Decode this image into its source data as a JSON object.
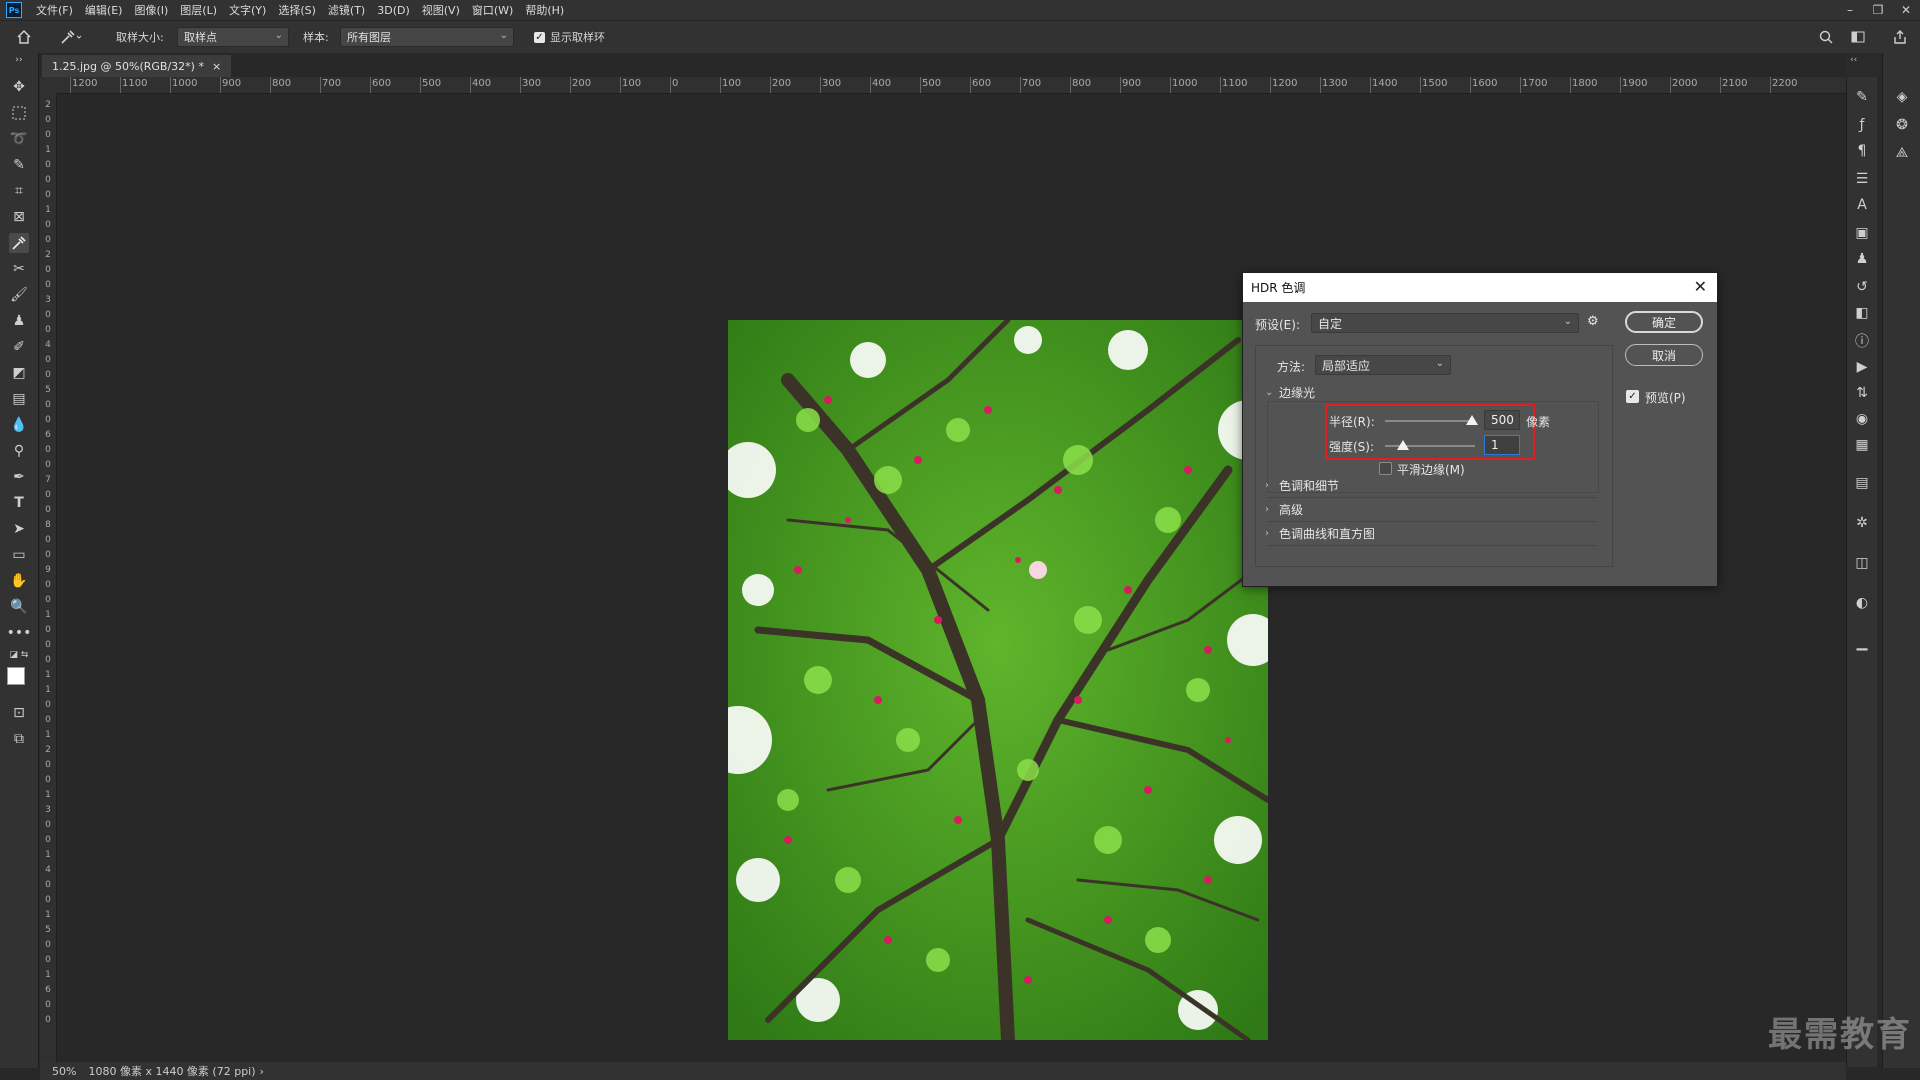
{
  "menubar": {
    "logo": "Ps",
    "items": [
      "文件(F)",
      "编辑(E)",
      "图像(I)",
      "图层(L)",
      "文字(Y)",
      "选择(S)",
      "滤镜(T)",
      "3D(D)",
      "视图(V)",
      "窗口(W)",
      "帮助(H)"
    ],
    "window_controls": [
      "–",
      "❐",
      "✕"
    ]
  },
  "options": {
    "sample_size_label": "取样大小:",
    "sample_size_value": "取样点",
    "sample_label": "样本:",
    "sample_value": "所有图层",
    "show_ring_label": "显示取样环",
    "show_ring_checked": true
  },
  "document": {
    "tab_title": "1.25.jpg @ 50%(RGB/32*) *",
    "tab_close": "×"
  },
  "ruler": {
    "h_labels": [
      "1200",
      "1100",
      "1000",
      "900",
      "800",
      "700",
      "600",
      "500",
      "400",
      "300",
      "200",
      "100",
      "0",
      "100",
      "200",
      "300",
      "400",
      "500",
      "600",
      "700",
      "800",
      "900",
      "1000",
      "1100",
      "1200",
      "1300",
      "1400",
      "1500",
      "1600",
      "1700",
      "1800",
      "1900",
      "2000",
      "2100",
      "2200"
    ],
    "v_labels": [
      "2",
      "0",
      "0",
      "1",
      "0",
      "0",
      "0",
      "1",
      "0",
      "0",
      "2",
      "0",
      "0",
      "3",
      "0",
      "0",
      "4",
      "0",
      "0",
      "5",
      "0",
      "0",
      "6",
      "0",
      "0",
      "7",
      "0",
      "0",
      "8",
      "0",
      "0",
      "9",
      "0",
      "0",
      "1",
      "0",
      "0",
      "0",
      "1",
      "1",
      "0",
      "0",
      "1",
      "2",
      "0",
      "0",
      "1",
      "3",
      "0",
      "0",
      "1",
      "4",
      "0",
      "0",
      "1",
      "5",
      "0",
      "0",
      "1",
      "6",
      "0",
      "0"
    ]
  },
  "status": {
    "zoom": "50%",
    "doc_info": "1080 像素 x 1440 像素 (72 ppi)",
    "arrow": "›"
  },
  "watermark": "最需教育",
  "dialog": {
    "title": "HDR 色调",
    "close": "✕",
    "preset_label": "预设(E):",
    "preset_value": "自定",
    "method_label": "方法:",
    "method_value": "局部适应",
    "ok": "确定",
    "cancel": "取消",
    "preview_label": "预览(P)",
    "preview_checked": true,
    "edge_glow": {
      "title": "边缘光",
      "radius_label": "半径(R):",
      "radius_value": "500",
      "radius_unit": "像素",
      "radius_fraction": 0.97,
      "strength_label": "强度(S):",
      "strength_value": "1",
      "strength_fraction": 0.2,
      "smooth_edges_label": "平滑边缘(M)",
      "smooth_edges_checked": false
    },
    "collapsed_sections": [
      "色调和细节",
      "高级",
      "色调曲线和直方图"
    ]
  },
  "colors": {
    "highlight_box": "#e02020",
    "focus": "#2b7bd9"
  }
}
